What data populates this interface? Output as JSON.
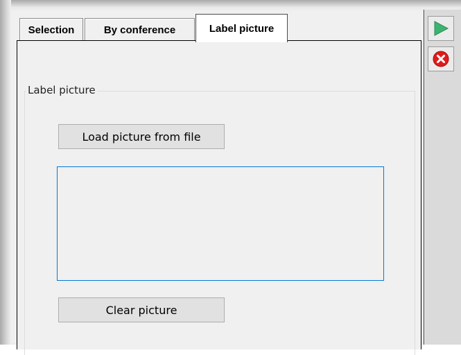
{
  "tabs": [
    {
      "label": "Selection",
      "selected": false
    },
    {
      "label": "By conference",
      "selected": false
    },
    {
      "label": "Label picture",
      "selected": true
    }
  ],
  "panel": {
    "group_caption": "Label picture",
    "load_button": "Load picture from file",
    "clear_button": "Clear picture",
    "picture_box": {
      "has_image": false
    }
  },
  "toolbar": {
    "run_icon": "play-icon",
    "cancel_icon": "cancel-icon",
    "run_color": "#3cb371",
    "cancel_color": "#e01b1b"
  },
  "colors": {
    "focus_border": "#0078d7",
    "button_face": "#e1e1e1",
    "background": "#f0f0f0"
  }
}
